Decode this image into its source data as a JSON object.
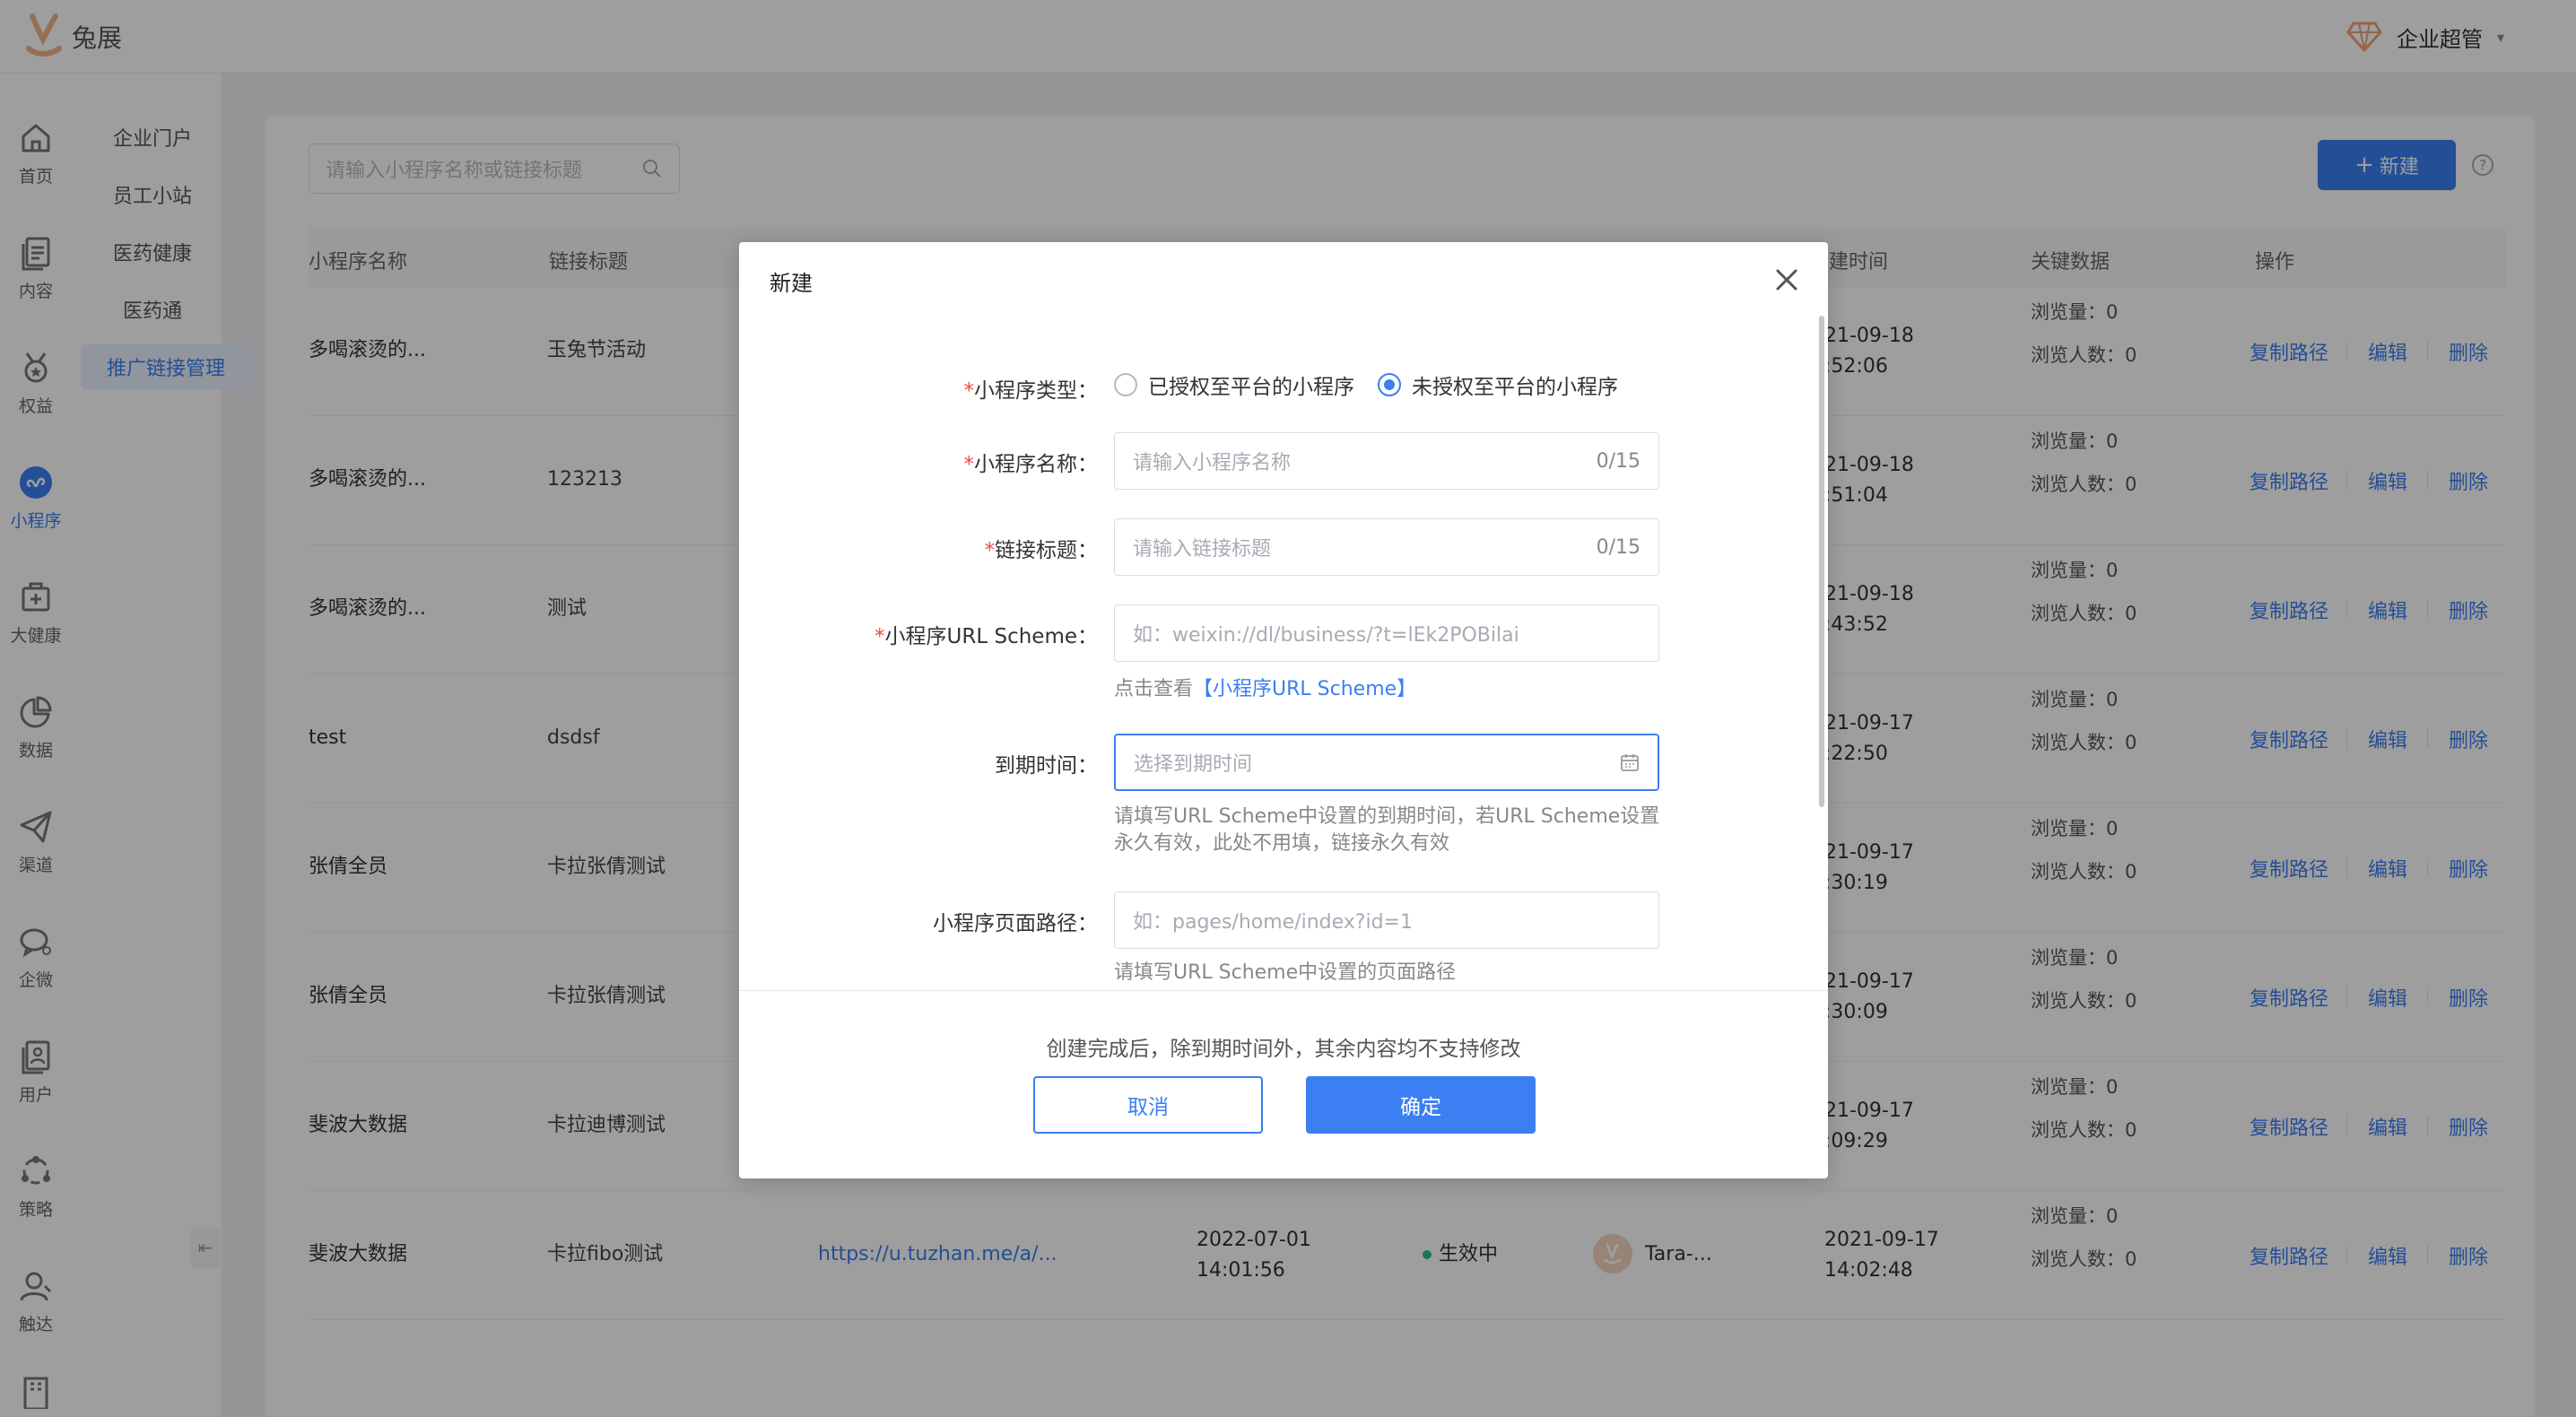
{
  "brand": {
    "name": "兔展"
  },
  "header": {
    "user_name": "企业超管"
  },
  "rail": {
    "items": [
      {
        "label": "首页",
        "icon": "home-icon"
      },
      {
        "label": "内容",
        "icon": "content-icon"
      },
      {
        "label": "权益",
        "icon": "medal-icon"
      },
      {
        "label": "小程序",
        "icon": "miniprogram-icon"
      },
      {
        "label": "大健康",
        "icon": "health-icon"
      },
      {
        "label": "数据",
        "icon": "pie-chart-icon"
      },
      {
        "label": "渠道",
        "icon": "send-icon"
      },
      {
        "label": "企微",
        "icon": "chat-icon"
      },
      {
        "label": "用户",
        "icon": "user-list-icon"
      },
      {
        "label": "策略",
        "icon": "strategy-icon"
      },
      {
        "label": "触达",
        "icon": "reach-icon"
      }
    ]
  },
  "submenu": {
    "items": [
      {
        "label": "企业门户"
      },
      {
        "label": "员工小站"
      },
      {
        "label": "医药健康"
      },
      {
        "label": "医药通"
      },
      {
        "label": "推广链接管理"
      }
    ]
  },
  "toolbar": {
    "search_placeholder": "请输入小程序名称或链接标题",
    "new_label": "新建"
  },
  "table": {
    "columns": [
      "小程序名称",
      "链接标题",
      "创建时间",
      "关键数据",
      "操作"
    ],
    "columns_partial": {
      "time": "建时间"
    },
    "stat_labels": {
      "views": "浏览量：",
      "visitors": "浏览人数："
    },
    "ops": {
      "copy": "复制路径",
      "edit": "编辑",
      "delete": "删除"
    },
    "rows": [
      {
        "name": "多喝滚烫的...",
        "title": "玉兔节活动",
        "date": "21-09-18",
        "time": ":52:06",
        "views": "0",
        "visitors": "0"
      },
      {
        "name": "多喝滚烫的...",
        "title": "123213",
        "date": "21-09-18",
        "time": ":51:04",
        "views": "0",
        "visitors": "0"
      },
      {
        "name": "多喝滚烫的...",
        "title": "测试",
        "date": "21-09-18",
        "time": ":43:52",
        "views": "0",
        "visitors": "0"
      },
      {
        "name": "test",
        "title": "dsdsf",
        "date": "21-09-17",
        "time": ":22:50",
        "views": "0",
        "visitors": "0"
      },
      {
        "name": "张倩全员",
        "title": "卡拉张倩测试",
        "date": "21-09-17",
        "time": ":30:19",
        "views": "0",
        "visitors": "0"
      },
      {
        "name": "张倩全员",
        "title": "卡拉张倩测试",
        "date": "21-09-17",
        "time": ":30:09",
        "views": "0",
        "visitors": "0"
      },
      {
        "name": "斐波大数据",
        "title": "卡拉迪博测试",
        "date": "21-09-17",
        "time": ":09:29",
        "views": "0",
        "visitors": "0"
      },
      {
        "name": "斐波大数据",
        "title": "卡拉fibo测试",
        "link": "https://u.tuzhan.me/a/...",
        "expire_date": "2022-07-01",
        "expire_time": "14:01:56",
        "status": "生效中",
        "creator": "Tara-...",
        "date": "2021-09-17",
        "time": "14:02:48",
        "views": "0",
        "visitors": "0"
      }
    ]
  },
  "modal": {
    "title": "新建",
    "type_label": "小程序类型：",
    "type_options": [
      {
        "label": "已授权至平台的小程序",
        "checked": false
      },
      {
        "label": "未授权至平台的小程序",
        "checked": true
      }
    ],
    "name_label": "小程序名称：",
    "name_placeholder": "请输入小程序名称",
    "name_counter": "0/15",
    "link_title_label": "链接标题：",
    "link_title_placeholder": "请输入链接标题",
    "link_title_counter": "0/15",
    "scheme_label": "小程序URL Scheme：",
    "scheme_placeholder": "如：weixin://dl/business/?t=lEk2POBilai",
    "scheme_hint_prefix": "点击查看",
    "scheme_hint_link": "【小程序URL Scheme】",
    "expire_label": "到期时间：",
    "expire_placeholder": "选择到期时间",
    "expire_hint": "请填写URL Scheme中设置的到期时间，若URL Scheme设置永久有效，此处不用填，链接永久有效",
    "path_label": "小程序页面路径：",
    "path_placeholder": "如：pages/home/index?id=1",
    "path_hint": "请填写URL Scheme中设置的页面路径",
    "footer_note": "创建完成后，除到期时间外，其余内容均不支持修改",
    "cancel_label": "取消",
    "ok_label": "确定"
  },
  "colors": {
    "accent": "#3b7ff2",
    "required": "#f0483e",
    "status_active": "#29c287"
  }
}
